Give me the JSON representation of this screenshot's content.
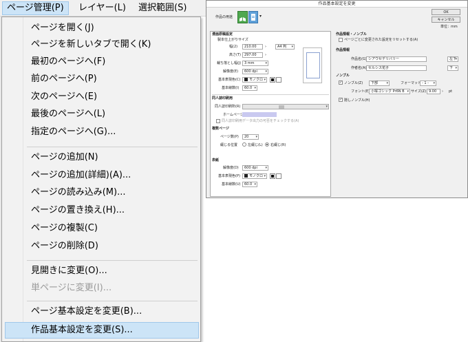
{
  "menubar": {
    "items": [
      "ページ管理(P)",
      "レイヤー(L)",
      "選択範囲(S)"
    ]
  },
  "menu": {
    "items": [
      "ページを開く(J)",
      "ページを新しいタブで開く(K)",
      "最初のページへ(F)",
      "前のページへ(P)",
      "次のページへ(E)",
      "最後のページへ(L)",
      "指定のページへ(G)...",
      "ページの追加(N)",
      "ページの追加(詳細)(A)...",
      "ページの読み込み(M)...",
      "ページの置き換え(H)...",
      "ページの複製(C)",
      "ページの削除(D)",
      "見開きに変更(O)...",
      "単ページに変更(I)...",
      "ページ基本設定を変更(B)...",
      "作品基本設定を変更(S)..."
    ]
  },
  "dialog": {
    "title": "作品基本設定を変更",
    "work_use_label": "作品の用途",
    "ok": "OK",
    "cancel": "キャンセル",
    "unit_label": "単位：mm",
    "binding": {
      "section": "漫画原稿設定",
      "finish_size": "製本仕上がりサイズ",
      "width_label": "幅(2)",
      "width_value": "210.00",
      "height_label": "高さ(T)",
      "height_value": "297.00",
      "paper_value": "A4 判",
      "bleed_label": "裁ち落とし幅(J)",
      "bleed_value": "3 mm",
      "resolution_label": "解像度(E)",
      "resolution_value": "600 dpi",
      "color_label": "基本表現色(C)",
      "color_value": "モノクロ",
      "line_label": "基本線数(I)",
      "line_value": "60.0"
    },
    "doujin": {
      "section": "同人誌印刷用",
      "printer_label": "同人誌印刷所(R)",
      "homepage_label": "ホームページ",
      "checkbox_label": "同人誌印刷用データ出力の可否をチェックする(A)"
    },
    "spread": {
      "section": "複数ページ",
      "pages_label": "ページ数(P)",
      "pages_value": "20",
      "binding_label": "綴じる位置",
      "left": "左綴じ(L)",
      "right": "右綴じ(R)"
    },
    "cover": {
      "section": "表紙",
      "resolution_label": "解像度(D)",
      "resolution_value": "600 dpi",
      "color_label": "基本表現色(P)",
      "color_value": "モノクロ",
      "line_label": "基本線数(U)",
      "line_value": "60.0"
    },
    "info": {
      "section": "作品情報・ノンブル",
      "reset_label": "ページごとに変更された設定をリセットする(A)",
      "work_info": "作品情報",
      "title_label": "作品名(G)",
      "title_value": "シアウセデリバリー",
      "title_pos": "左下",
      "author_label": "作者名(A)",
      "author_value": "セルシス花子",
      "author_pos": "下"
    },
    "nombre": {
      "section": "ノンブル",
      "nombre_label": "ノンブル(Z)",
      "position_value": "下部",
      "format_label": "フォーマット",
      "format_value": "- 1 -",
      "font_label": "フォント(E)",
      "font_value": "小塚ゴシック Pr6N B",
      "size_label": "サイズ(Z)",
      "size_value": "9.00",
      "size_unit": "pt",
      "hidden_label": "隠しノンブル(H)"
    }
  }
}
